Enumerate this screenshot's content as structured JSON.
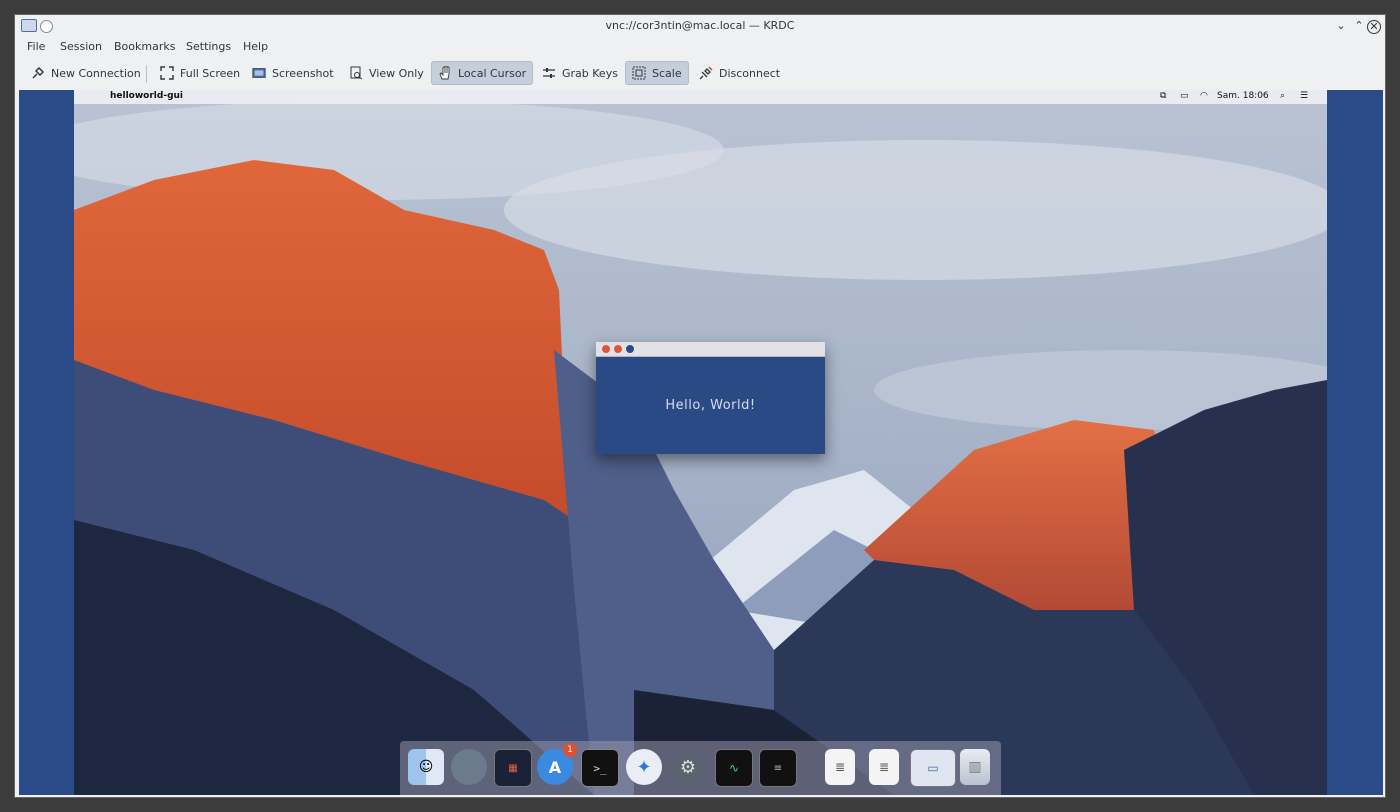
{
  "window": {
    "title": "vnc://cor3ntin@mac.local — KRDC"
  },
  "menu": [
    "File",
    "Session",
    "Bookmarks",
    "Settings",
    "Help"
  ],
  "toolbar": {
    "new_connection": "New Connection",
    "full_screen": "Full Screen",
    "screenshot": "Screenshot",
    "view_only": "View Only",
    "local_cursor": "Local Cursor",
    "grab_keys": "Grab Keys",
    "scale": "Scale",
    "disconnect": "Disconnect"
  },
  "remote": {
    "menubar": {
      "app_name": "helloworld-gui",
      "clock": "Sam. 18:06"
    },
    "hello_window": {
      "text": "Hello, World!"
    },
    "dock": {
      "items": [
        "finder-icon",
        "launchpad-icon",
        "photo-viewer-icon",
        "app-store-icon",
        "terminal-icon",
        "safari-icon",
        "system-preferences-icon",
        "activity-monitor-icon",
        "console-icon",
        "document-icon",
        "document-icon",
        "preview-icon",
        "trash-icon"
      ],
      "app_store_badge": "1"
    }
  },
  "colors": {
    "accent": "#2b4b88",
    "active_tool": "#c5cfda",
    "sunlit_rock": "#d65a32"
  }
}
